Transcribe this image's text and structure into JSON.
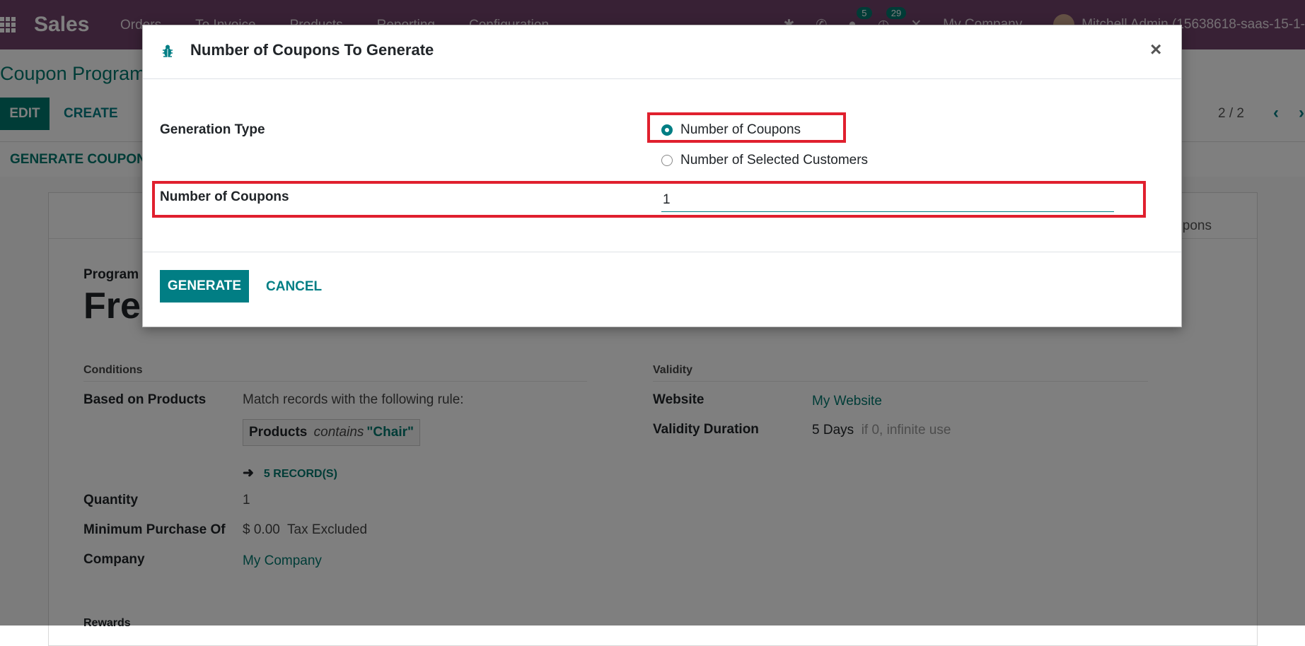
{
  "navbar": {
    "app_name": "Sales",
    "menu": [
      "Orders",
      "To Invoice",
      "Products",
      "Reporting",
      "Configuration"
    ],
    "messages_count": "5",
    "activities_count": "29",
    "company": "My Company",
    "user": "Mitchell Admin (15638618-saas-15-1-"
  },
  "control_panel": {
    "breadcrumb": "Coupon Program",
    "edit_label": "EDIT",
    "create_label": "CREATE",
    "pager": "2 / 2",
    "generate_coupon_label": "GENERATE COUPON"
  },
  "form": {
    "smart_button_label": "Coupons",
    "program_name_label": "Program Name",
    "program_name": "Free Chair Coupon",
    "conditions": {
      "title": "Conditions",
      "based_on_products_label": "Based on Products",
      "rule_text": "Match records with the following rule:",
      "domain_field": "Products",
      "domain_operator": "contains",
      "domain_value": "\"Chair\"",
      "records_link": "5 RECORD(S)",
      "quantity_label": "Quantity",
      "quantity_value": "1",
      "min_purchase_label": "Minimum Purchase Of",
      "min_purchase_value": "$ 0.00",
      "min_purchase_tax": "Tax Excluded",
      "company_label": "Company",
      "company_value": "My Company"
    },
    "validity": {
      "title": "Validity",
      "website_label": "Website",
      "website_value": "My Website",
      "duration_label": "Validity Duration",
      "duration_value": "5 Days",
      "duration_hint": "if 0, infinite use"
    },
    "rewards_title": "Rewards"
  },
  "modal": {
    "title": "Number of Coupons To Generate",
    "generation_type_label": "Generation Type",
    "options": [
      "Number of Coupons",
      "Number of Selected Customers"
    ],
    "selected_option": "Number of Coupons",
    "number_label": "Number of Coupons",
    "number_value": "1",
    "generate_label": "GENERATE",
    "cancel_label": "CANCEL",
    "close_glyph": "×"
  },
  "colors": {
    "navbar": "#71436a",
    "primary": "#017e84",
    "highlight": "#e0202e"
  }
}
